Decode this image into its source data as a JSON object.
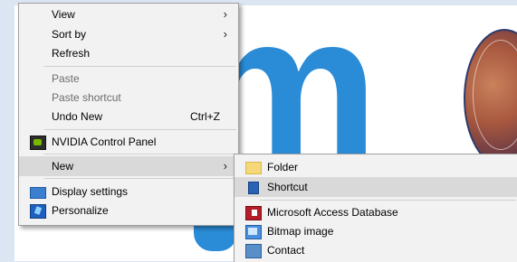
{
  "context_menu": {
    "items": [
      {
        "label": "View",
        "submenu": true
      },
      {
        "label": "Sort by",
        "submenu": true
      },
      {
        "label": "Refresh"
      },
      {
        "label": "Paste",
        "disabled": true
      },
      {
        "label": "Paste shortcut",
        "disabled": true
      },
      {
        "label": "Undo New",
        "shortcut": "Ctrl+Z"
      },
      {
        "label": "NVIDIA Control Panel",
        "icon": "nvidia-icon"
      },
      {
        "label": "New",
        "submenu": true,
        "highlighted": true
      },
      {
        "label": "Display settings",
        "icon": "display-settings-icon"
      },
      {
        "label": "Personalize",
        "icon": "personalize-icon"
      }
    ]
  },
  "new_submenu": {
    "items": [
      {
        "label": "Folder",
        "icon": "folder-icon"
      },
      {
        "label": "Shortcut",
        "icon": "shortcut-icon",
        "highlighted": true
      },
      {
        "label": "Microsoft Access Database",
        "icon": "access-database-icon"
      },
      {
        "label": "Bitmap image",
        "icon": "bitmap-image-icon"
      },
      {
        "label": "Contact",
        "icon": "contact-icon"
      }
    ]
  },
  "chevron_glyph": "›",
  "colors": {
    "highlight": "#d9d9d9",
    "menu_bg": "#f2f2f2",
    "wallpaper_blue": "#2a8bd6",
    "disabled_text": "#6d6d6d"
  }
}
